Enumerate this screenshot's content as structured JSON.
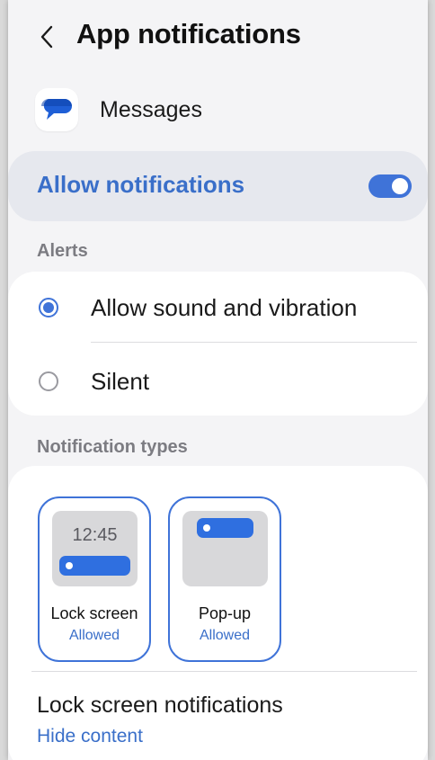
{
  "header": {
    "back_icon": "chevron-left-icon",
    "title": "App notifications"
  },
  "app": {
    "icon": "messages-chat-bubble-icon",
    "name": "Messages"
  },
  "allow_notifications": {
    "label": "Allow notifications",
    "enabled": true
  },
  "alerts": {
    "section_label": "Alerts",
    "options": [
      {
        "label": "Allow sound and vibration",
        "selected": true
      },
      {
        "label": "Silent",
        "selected": false
      }
    ]
  },
  "notification_types": {
    "section_label": "Notification types",
    "tiles": [
      {
        "name": "Lock screen",
        "status": "Allowed",
        "preview_time": "12:45"
      },
      {
        "name": "Pop-up",
        "status": "Allowed"
      }
    ]
  },
  "lock_screen_notifications": {
    "title": "Lock screen notifications",
    "value": "Hide content"
  },
  "colors": {
    "accent": "#3f73d8",
    "accent_text": "#3a6fc9",
    "background": "#f4f4f6",
    "card": "#ffffff"
  }
}
